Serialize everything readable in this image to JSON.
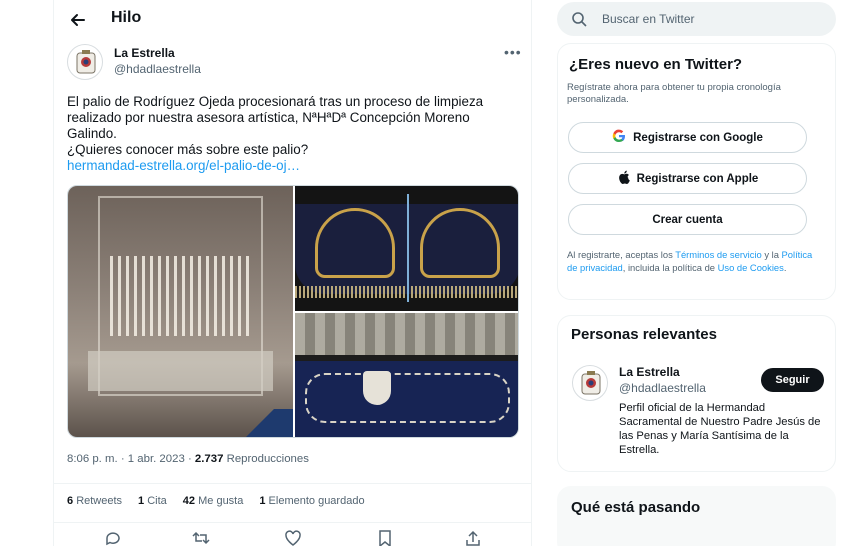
{
  "header": {
    "title": "Hilo"
  },
  "tweet": {
    "author_name": "La Estrella",
    "author_handle": "@hdadlaestrella",
    "text_line1": "El palio de Rodríguez Ojeda procesionará tras un proceso de limpieza realizado por nuestra asesora artística, NªHªDª Concepción Moreno Galindo.",
    "text_line2": "¿Quieres conocer más sobre este palio?",
    "link": "hermandad-estrella.org/el-palio-de-oj…",
    "time": "8:06 p. m. · 1 abr. 2023 · ",
    "views_count": "2.737",
    "views_label": " Reproducciones",
    "stats": {
      "retweets_count": "6",
      "retweets_label": "Retweets",
      "quotes_count": "1",
      "quotes_label": "Cita",
      "likes_count": "42",
      "likes_label": "Me gusta",
      "saves_count": "1",
      "saves_label": "Elemento guardado"
    }
  },
  "search": {
    "placeholder": "Buscar en Twitter"
  },
  "signup": {
    "title": "¿Eres nuevo en Twitter?",
    "subtitle": "Regístrate ahora para obtener tu propia cronología personalizada.",
    "google_label": "Registrarse con Google",
    "apple_label": "Registrarse con Apple",
    "create_label": "Crear cuenta",
    "legal_prefix": "Al registrarte, aceptas los ",
    "legal_terms": "Términos de servicio",
    "legal_mid1": " y la ",
    "legal_privacy": "Política de privacidad",
    "legal_mid2": ", incluida la política de ",
    "legal_cookies": "Uso de Cookies",
    "legal_suffix": "."
  },
  "relevant": {
    "title": "Personas relevantes",
    "name": "La Estrella",
    "handle": "@hdadlaestrella",
    "follow_label": "Seguir",
    "bio": "Perfil oficial de la Hermandad Sacramental de Nuestro Padre Jesús de las Penas y María Santísima de la Estrella."
  },
  "trending": {
    "title": "Qué está pasando"
  },
  "colors": {
    "accent": "#1d9bf0",
    "text": "#0f1419",
    "secondary": "#536471"
  }
}
